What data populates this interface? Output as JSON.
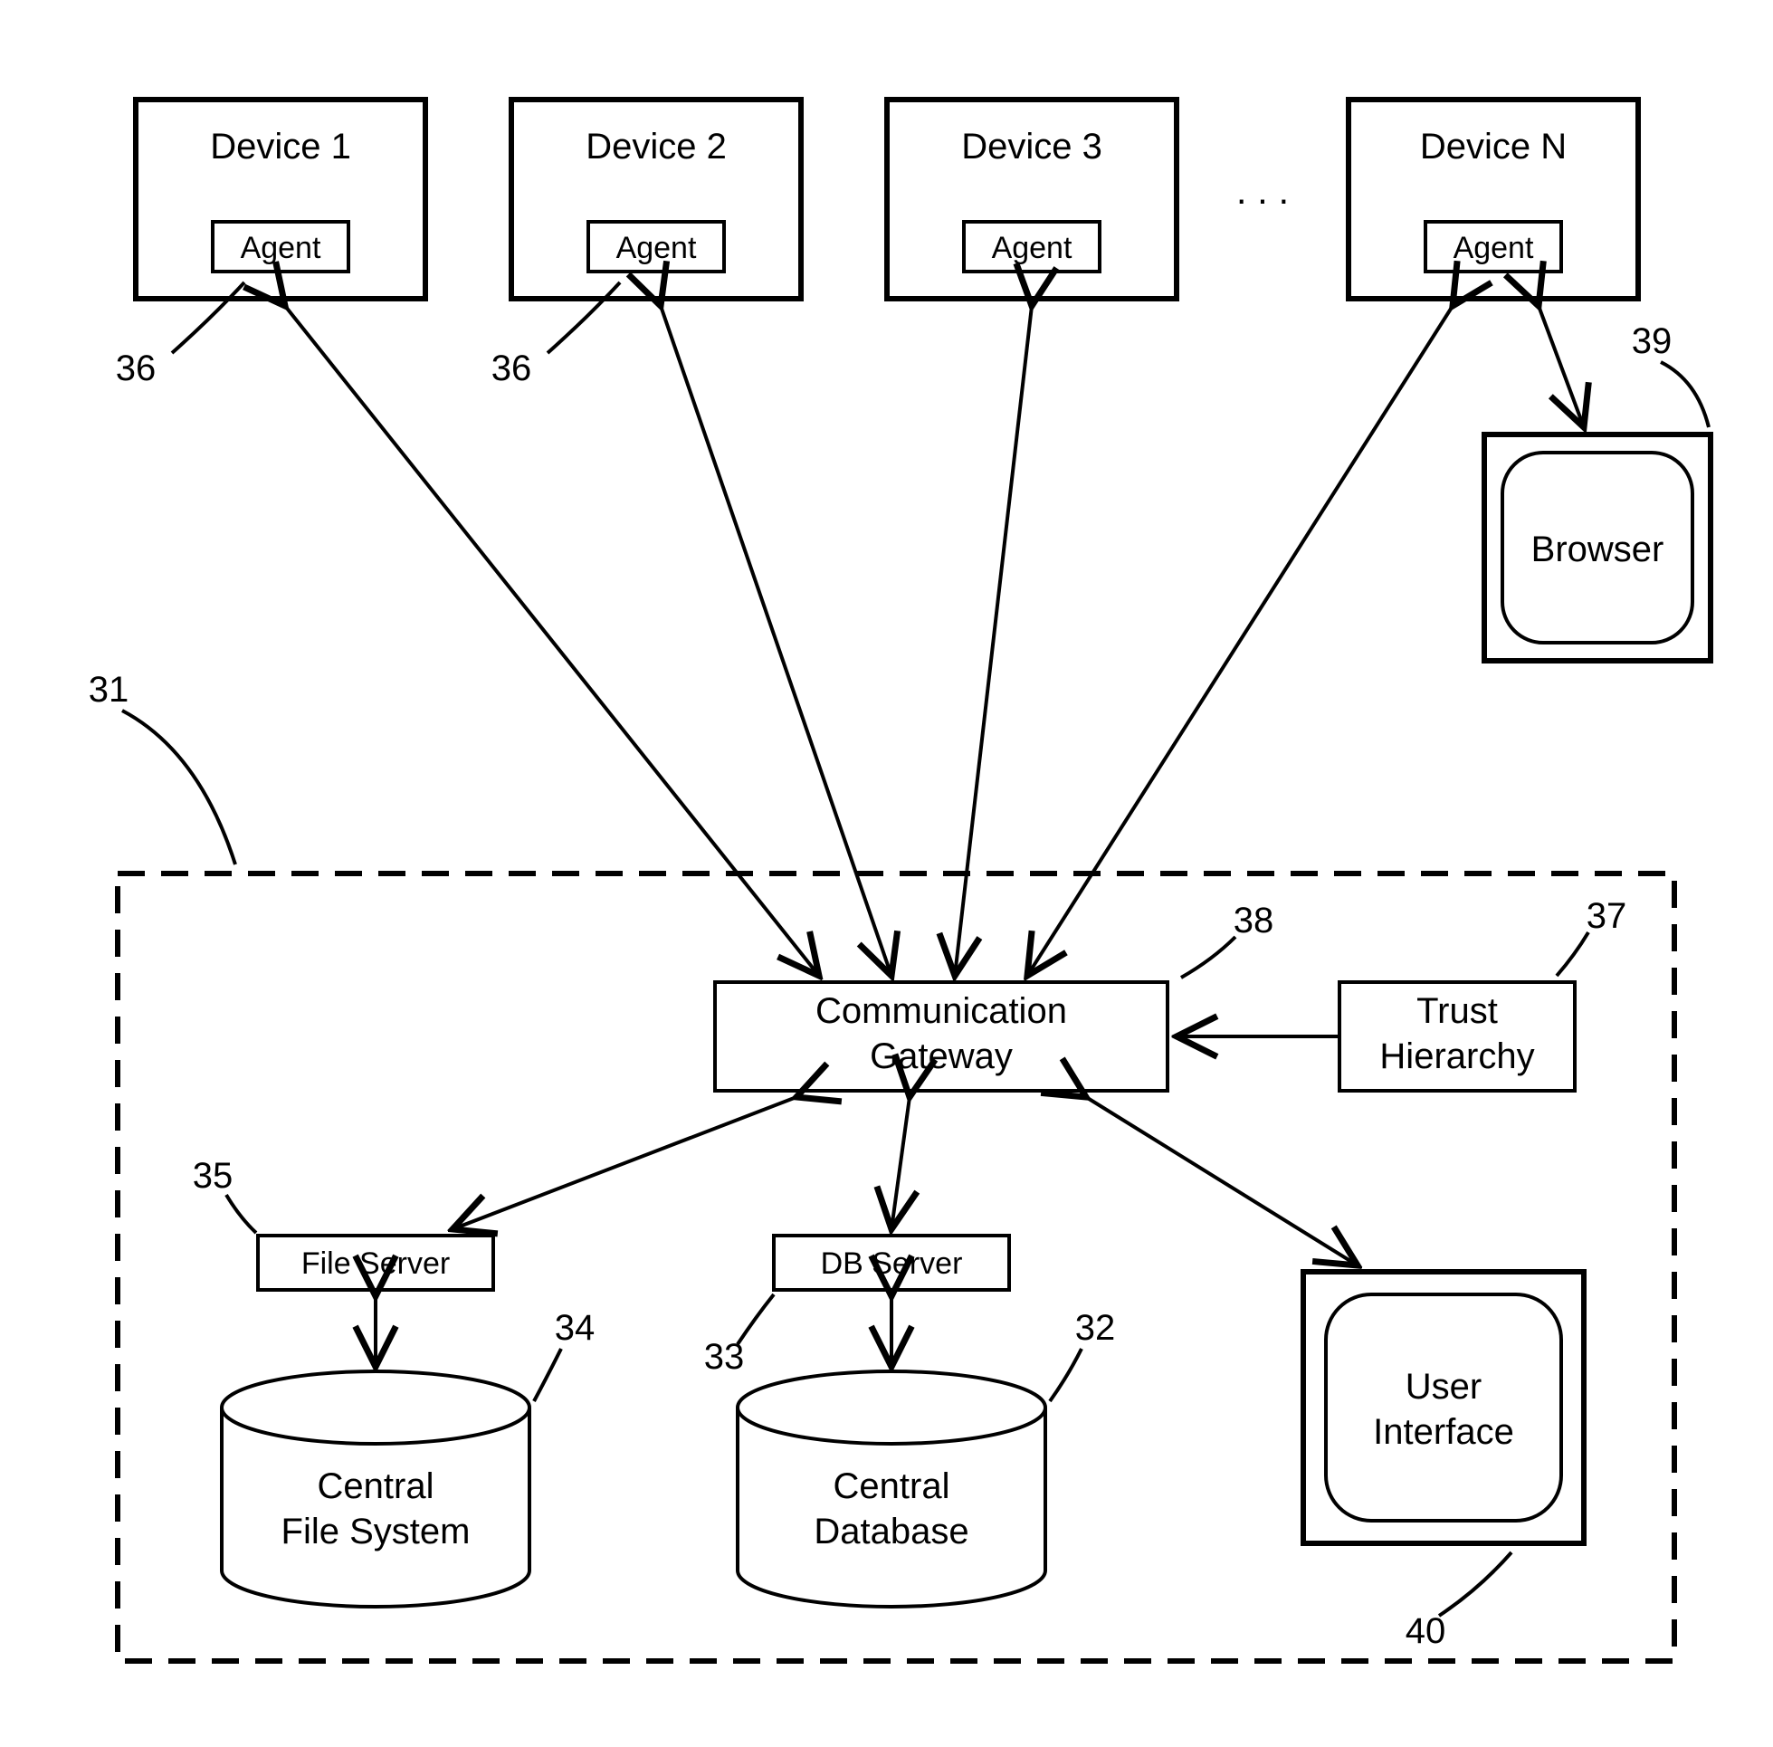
{
  "devices": [
    {
      "title": "Device 1",
      "agent": "Agent"
    },
    {
      "title": "Device 2",
      "agent": "Agent"
    },
    {
      "title": "Device 3",
      "agent": "Agent"
    },
    {
      "title": "Device N",
      "agent": "Agent"
    }
  ],
  "ellipsis": ". . .",
  "browser": {
    "label": "Browser"
  },
  "gateway": {
    "line1": "Communication",
    "line2": "Gateway"
  },
  "trust": {
    "line1": "Trust",
    "line2": "Hierarchy"
  },
  "file_server": "File Server",
  "db_server": "DB Server",
  "cfs": {
    "line1": "Central",
    "line2": "File System"
  },
  "cdb": {
    "line1": "Central",
    "line2": "Database"
  },
  "ui": {
    "line1": "User",
    "line2": "Interface"
  },
  "refs": {
    "r31": "31",
    "r32": "32",
    "r33": "33",
    "r34": "34",
    "r35": "35",
    "r36a": "36",
    "r36b": "36",
    "r37": "37",
    "r38": "38",
    "r39": "39",
    "r40": "40"
  }
}
